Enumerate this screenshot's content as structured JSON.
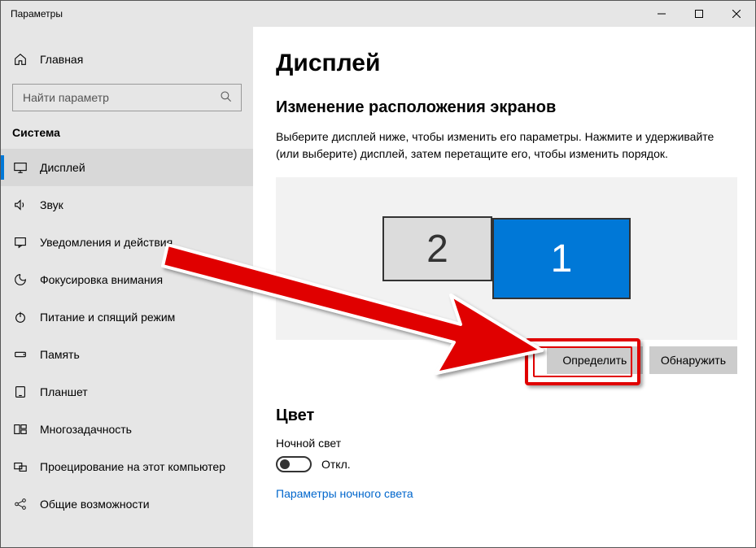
{
  "window": {
    "title": "Параметры"
  },
  "sidebar": {
    "home": "Главная",
    "search_placeholder": "Найти параметр",
    "category": "Система",
    "items": [
      {
        "label": "Дисплей",
        "icon": "display-icon",
        "selected": true
      },
      {
        "label": "Звук",
        "icon": "sound-icon"
      },
      {
        "label": "Уведомления и действия",
        "icon": "notifications-icon"
      },
      {
        "label": "Фокусировка внимания",
        "icon": "focus-icon"
      },
      {
        "label": "Питание и спящий режим",
        "icon": "power-icon"
      },
      {
        "label": "Память",
        "icon": "storage-icon"
      },
      {
        "label": "Планшет",
        "icon": "tablet-icon"
      },
      {
        "label": "Многозадачность",
        "icon": "multitask-icon"
      },
      {
        "label": "Проецирование на этот компьютер",
        "icon": "project-icon"
      },
      {
        "label": "Общие возможности",
        "icon": "shared-icon"
      }
    ]
  },
  "content": {
    "title": "Дисплей",
    "arrange_heading": "Изменение расположения экранов",
    "arrange_desc": "Выберите дисплей ниже, чтобы изменить его параметры. Нажмите и удерживайте (или выберите) дисплей, затем перетащите его, чтобы изменить порядок.",
    "monitor2": "2",
    "monitor1": "1",
    "identify_btn": "Определить",
    "detect_btn": "Обнаружить",
    "color_heading": "Цвет",
    "nightlight_label": "Ночной свет",
    "toggle_state": "Откл.",
    "nightlight_link": "Параметры ночного света"
  }
}
